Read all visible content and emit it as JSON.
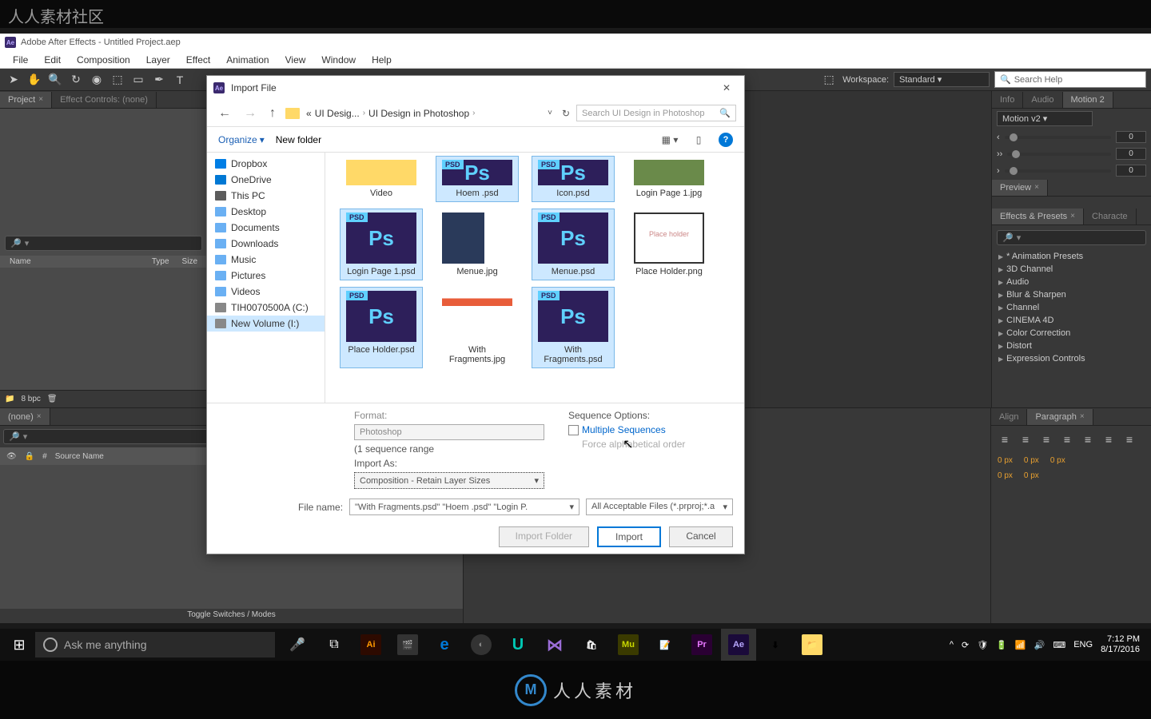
{
  "watermark": "人人素材社区",
  "bottom_watermark": "人人素材",
  "ae": {
    "title": "Adobe After Effects - Untitled Project.aep",
    "menu": [
      "File",
      "Edit",
      "Composition",
      "Layer",
      "Effect",
      "Animation",
      "View",
      "Window",
      "Help"
    ],
    "workspace_label": "Workspace:",
    "workspace_value": "Standard",
    "search_help_placeholder": "Search Help",
    "project_tab": "Project",
    "effect_controls_tab": "Effect Controls: (none)",
    "project_cols": {
      "name": "Name",
      "type": "Type",
      "size": "Size"
    },
    "bpc": "8 bpc",
    "timeline_none": "(none)",
    "source_name": "Source Name",
    "toggle_switches": "Toggle Switches / Modes"
  },
  "right": {
    "tabs1": [
      "Info",
      "Audio",
      "Motion 2"
    ],
    "motion_select": "Motion v2",
    "vals": [
      "0",
      "0",
      "0"
    ],
    "preview": "Preview",
    "tabs2": [
      "Effects & Presets",
      "Characte"
    ],
    "effects": [
      "* Animation Presets",
      "3D Channel",
      "Audio",
      "Blur & Sharpen",
      "Channel",
      "CINEMA 4D",
      "Color Correction",
      "Distort",
      "Expression Controls"
    ],
    "align": "Align",
    "paragraph": "Paragraph",
    "px": "0 px"
  },
  "dialog": {
    "title": "Import File",
    "breadcrumb": [
      "UI Desig...",
      "UI Design in Photoshop"
    ],
    "search_placeholder": "Search UI Design in Photoshop",
    "organize": "Organize",
    "new_folder": "New folder",
    "tree": [
      {
        "label": "Dropbox",
        "ico": "dropbox"
      },
      {
        "label": "OneDrive",
        "ico": "onedrive"
      },
      {
        "label": "This PC",
        "ico": "pc"
      },
      {
        "label": "Desktop",
        "ico": "folder"
      },
      {
        "label": "Documents",
        "ico": "folder"
      },
      {
        "label": "Downloads",
        "ico": "folder"
      },
      {
        "label": "Music",
        "ico": "folder"
      },
      {
        "label": "Pictures",
        "ico": "folder"
      },
      {
        "label": "Videos",
        "ico": "folder"
      },
      {
        "label": "TIH0070500A (C:)",
        "ico": "drive"
      },
      {
        "label": "New Volume (I:)",
        "ico": "drive",
        "selected": true
      }
    ],
    "files": [
      {
        "name": "Video",
        "type": "folder",
        "partial": true
      },
      {
        "name": "Hoem .psd",
        "type": "psd",
        "partial": true,
        "selected": true
      },
      {
        "name": "Icon.psd",
        "type": "psd",
        "partial": true,
        "selected": true
      },
      {
        "name": "Login Page 1.jpg",
        "type": "jpg-login",
        "partial": true
      },
      {
        "name": "Login Page 1.psd",
        "type": "psd",
        "selected": true
      },
      {
        "name": "Menue.jpg",
        "type": "jpg-menu"
      },
      {
        "name": "Menue.psd",
        "type": "psd",
        "selected": true
      },
      {
        "name": "Place Holder.png",
        "type": "png"
      },
      {
        "name": "Place Holder.psd",
        "type": "psd",
        "selected": true
      },
      {
        "name": "With Fragments.jpg",
        "type": "jpg-frag"
      },
      {
        "name": "With Fragments.psd",
        "type": "psd",
        "selected": true
      }
    ],
    "format_label": "Format:",
    "format_value": "Photoshop",
    "seq_range": "(1 sequence range",
    "import_as_label": "Import As:",
    "import_as_value": "Composition - Retain Layer Sizes",
    "seq_opts_label": "Sequence Options:",
    "multi_seq": "Multiple Sequences",
    "force_alpha": "Force alphabetical order",
    "filename_label": "File name:",
    "filename_value": "\"With Fragments.psd\" \"Hoem .psd\" \"Login P.",
    "filter": "All Acceptable Files (*.prproj;*.a",
    "btn_import_folder": "Import Folder",
    "btn_import": "Import",
    "btn_cancel": "Cancel"
  },
  "taskbar": {
    "cortana": "Ask me anything",
    "lang": "ENG",
    "time": "7:12 PM",
    "date": "8/17/2016"
  }
}
